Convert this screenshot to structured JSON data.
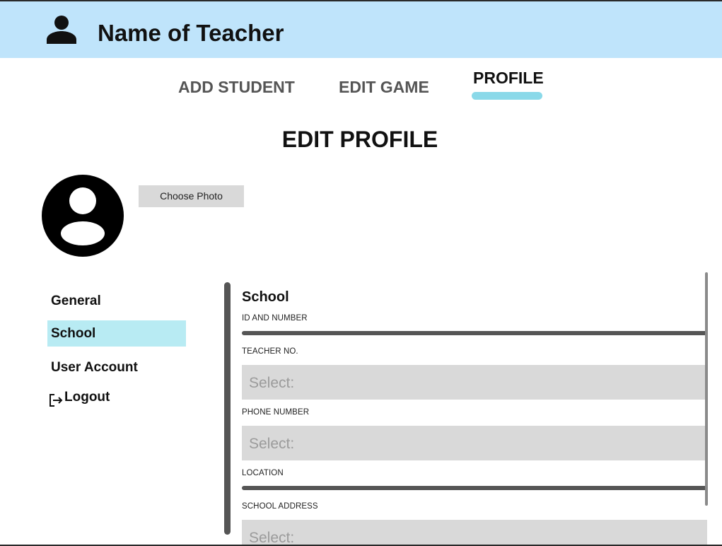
{
  "header": {
    "teacher_name": "Name of Teacher",
    "icon": "person-icon"
  },
  "nav": {
    "tabs": [
      {
        "label": "ADD STUDENT",
        "active": false
      },
      {
        "label": "EDIT GAME",
        "active": false
      },
      {
        "label": "PROFILE",
        "active": true
      }
    ]
  },
  "page_title": "EDIT PROFILE",
  "profile_photo": {
    "icon": "avatar-icon",
    "choose_photo_label": "Choose Photo"
  },
  "sidebar": {
    "items": [
      {
        "label": "General",
        "active": false
      },
      {
        "label": "School",
        "active": true
      },
      {
        "label": "User Account",
        "active": false
      },
      {
        "label": "Logout",
        "active": false,
        "icon": "logout-icon"
      }
    ]
  },
  "form": {
    "section_title": "School",
    "fields": [
      {
        "label": "ID AND NUMBER"
      },
      {
        "label": "TEACHER NO.",
        "placeholder": "Select:"
      },
      {
        "label": "PHONE NUMBER",
        "placeholder": "Select:"
      },
      {
        "label": "LOCATION"
      },
      {
        "label": "SCHOOL ADDRESS",
        "placeholder": "Select:"
      }
    ]
  },
  "colors": {
    "header_bg": "#bfe4fb",
    "active_tab_indicator": "#8ad9e9",
    "sidebar_active_bg": "#b8ebf3",
    "field_bg": "#d9d9d9",
    "placeholder_text": "#9b9b9b",
    "inactive_tab_text": "#555555"
  }
}
